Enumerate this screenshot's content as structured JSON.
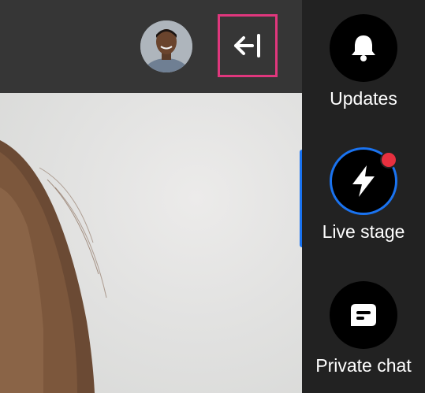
{
  "header": {
    "avatar_icon": "user-avatar",
    "collapse_icon": "arrow-left-to-line-icon"
  },
  "sidebar": {
    "items": [
      {
        "label": "Updates",
        "icon": "bell-icon",
        "active": false,
        "notification": false
      },
      {
        "label": "Live stage",
        "icon": "lightning-bolt-icon",
        "active": true,
        "notification": true
      },
      {
        "label": "Private chat",
        "icon": "chat-bubble-icon",
        "active": false,
        "notification": false
      }
    ]
  },
  "colors": {
    "accent": "#1a73f0",
    "highlight": "#e0377d",
    "notification": "#e8303f"
  }
}
